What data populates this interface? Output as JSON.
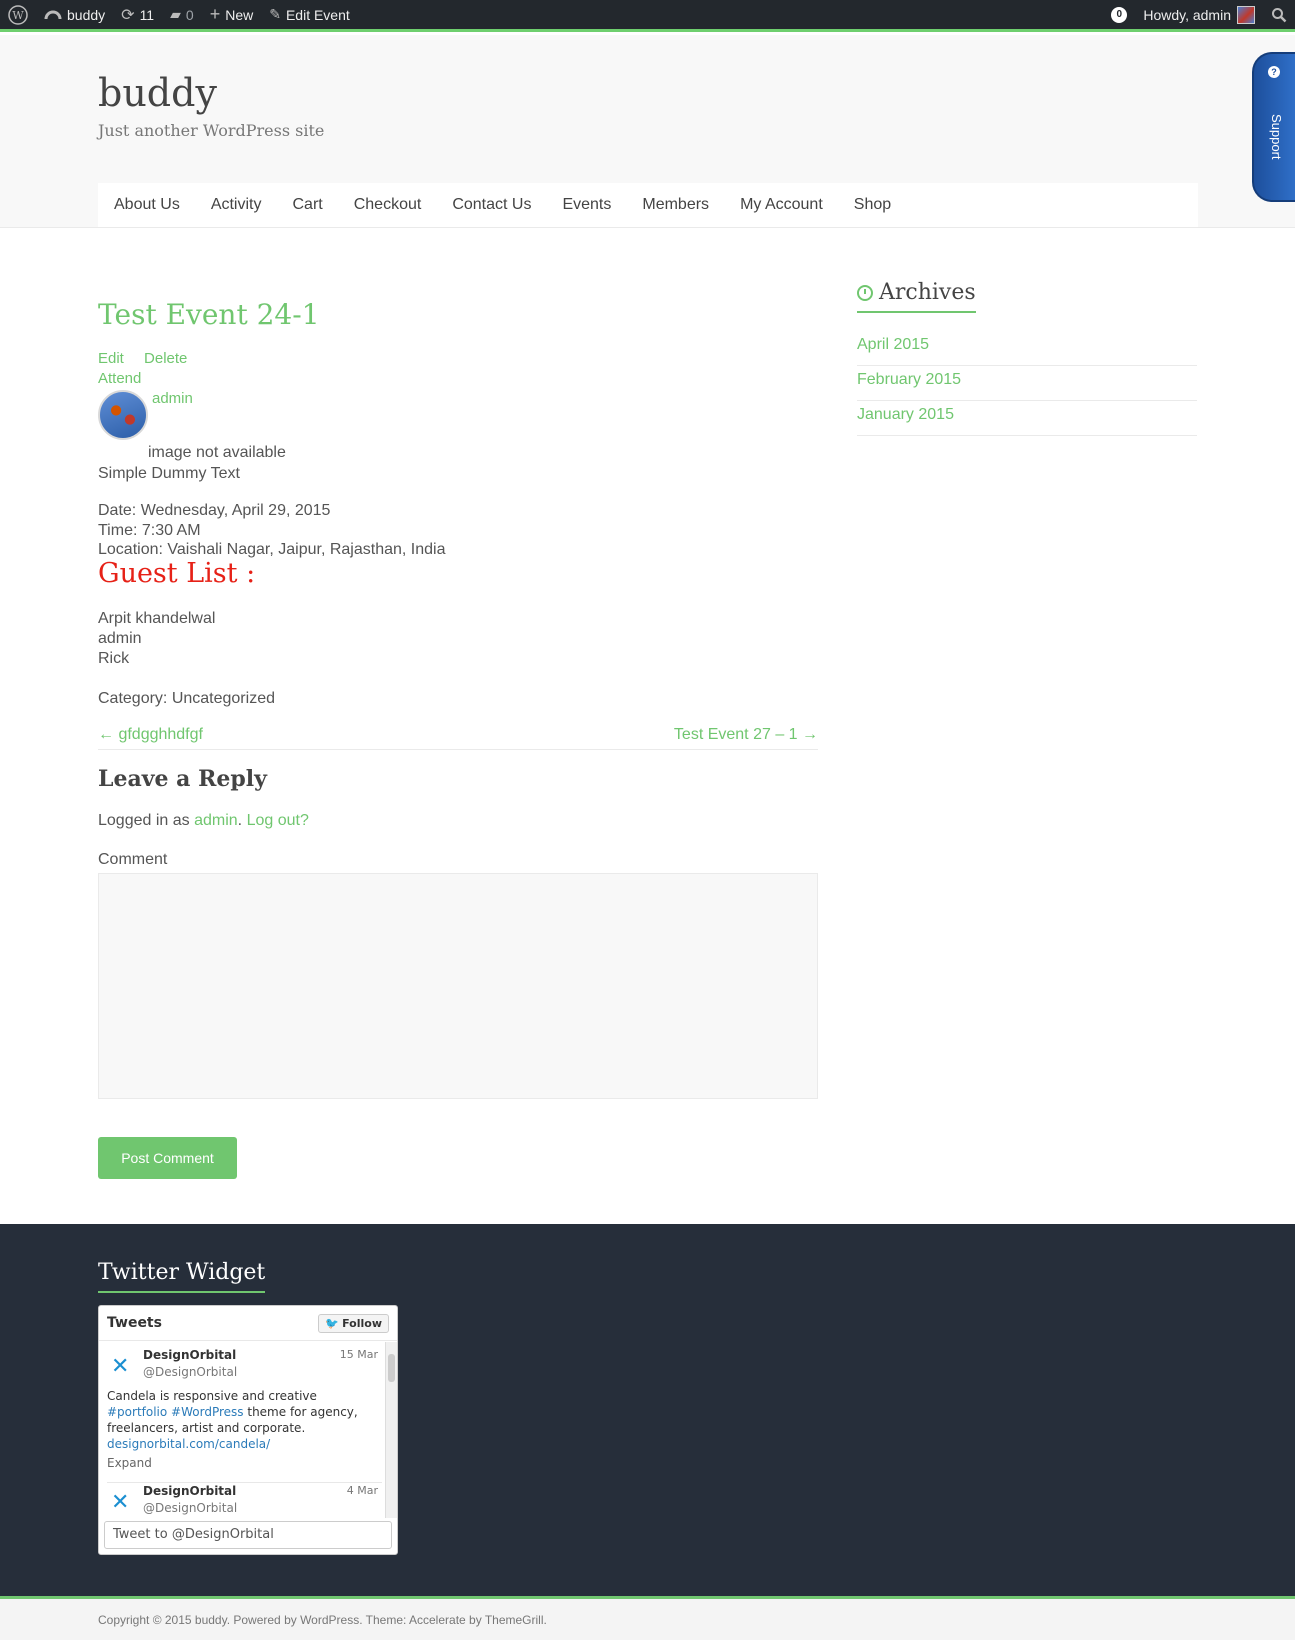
{
  "admin_bar": {
    "site_name": "buddy",
    "updates_count": "11",
    "comments_count": "0",
    "new_label": "New",
    "edit_label": "Edit Event",
    "notifications": "0",
    "howdy": "Howdy, admin"
  },
  "header": {
    "site_title": "buddy",
    "site_description": "Just another WordPress site",
    "menu": [
      "About Us",
      "Activity",
      "Cart",
      "Checkout",
      "Contact Us",
      "Events",
      "Members",
      "My Account",
      "Shop"
    ],
    "support_label": "Support"
  },
  "event": {
    "title": "Test Event 24-1",
    "edit_label": "Edit",
    "delete_label": "Delete",
    "attend_label": "Attend",
    "author": "admin",
    "image_text": "image not available",
    "description": "Simple Dummy Text",
    "date": "Date: Wednesday, April 29, 2015",
    "time": "Time: 7:30 AM",
    "location": "Location: Vaishali Nagar, Jaipur, Rajasthan, India",
    "guest_list_title": "Guest List :",
    "guests": [
      "Arpit khandelwal",
      "admin",
      "Rick"
    ],
    "category": "Category: Uncategorized"
  },
  "post_nav": {
    "prev": "← gfdgghhdfgf",
    "next": "Test Event 27 – 1 →"
  },
  "reply": {
    "title": "Leave a Reply",
    "logged_in_prefix": "Logged in as",
    "logged_in_user": "admin",
    "logout": "Log out?",
    "comment_label": "Comment",
    "submit_label": "Post Comment"
  },
  "sidebar": {
    "archives_title": "Archives",
    "archives": [
      "April 2015",
      "February 2015",
      "January 2015"
    ]
  },
  "footer": {
    "twitter_title": "Twitter Widget",
    "tweets_label": "Tweets",
    "follow_label": "Follow",
    "tweets": [
      {
        "name": "DesignOrbital",
        "handle": "@DesignOrbital",
        "date": "15 Mar",
        "text_1": "Candela is responsive and creative",
        "hashtags": "#portfolio #WordPress",
        "text_2": "theme for agency,",
        "text_3": "freelancers, artist and corporate.",
        "link": "designorbital.com/candela/",
        "expand": "Expand"
      },
      {
        "name": "DesignOrbital",
        "handle": "@DesignOrbital",
        "date": "4 Mar"
      }
    ],
    "tweet_to": "Tweet to @DesignOrbital",
    "copyright": "Copyright © 2015 buddy. Powered by WordPress. Theme: Accelerate by ThemeGrill."
  },
  "colors": {
    "accent": "#70c66f",
    "admin_bar": "#23282d",
    "footer_bg": "#262e3a",
    "guest_title": "#e62117"
  }
}
